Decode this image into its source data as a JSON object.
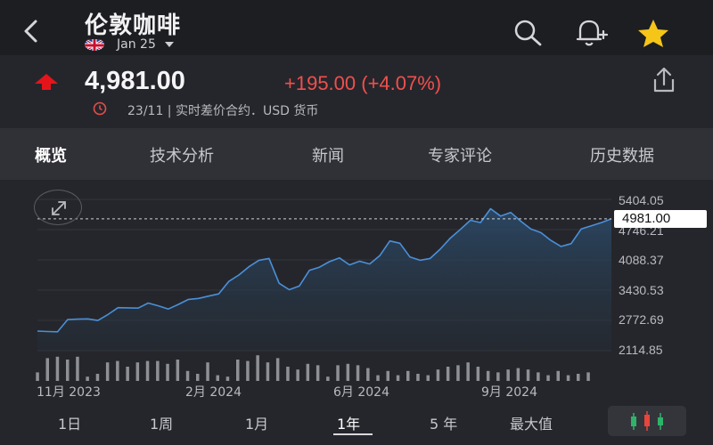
{
  "header": {
    "title": "伦敦咖啡",
    "contract": "Jan 25",
    "flag_icon": "uk-flag-icon",
    "icons": [
      "back-icon",
      "search-icon",
      "alert-add-icon",
      "star-icon"
    ],
    "star_color": "#f5c518"
  },
  "quote": {
    "price": "4,981.00",
    "change": "+195.00 (+4.07%)",
    "direction_icon": "arrow-up-icon",
    "meta": "23/11 | 实时差价合约．USD 货币",
    "up_color": "#f0504d"
  },
  "tabs": [
    {
      "label": "概览",
      "active": true
    },
    {
      "label": "技术分析",
      "active": false
    },
    {
      "label": "新闻",
      "active": false
    },
    {
      "label": "专家评论",
      "active": false
    },
    {
      "label": "历史数据",
      "active": false
    }
  ],
  "chart_data": {
    "type": "area",
    "line_color": "#4a90d9",
    "y_ticks": [
      "5404.05",
      "4746.21",
      "4088.37",
      "3430.53",
      "2772.69",
      "2114.85"
    ],
    "ylim": [
      2114.85,
      5404.05
    ],
    "x_ticks": [
      "11月 2023",
      "2月 2024",
      "6月 2024",
      "9月 2024"
    ],
    "last_price_label": "4981.00",
    "last_price": 4981.0,
    "values": [
      2540,
      2530,
      2525,
      2790,
      2800,
      2805,
      2770,
      2900,
      3050,
      3045,
      3040,
      3150,
      3090,
      3020,
      3120,
      3230,
      3250,
      3300,
      3350,
      3620,
      3760,
      3940,
      4080,
      4120,
      3580,
      3440,
      3520,
      3860,
      3930,
      4050,
      4130,
      3980,
      4060,
      4000,
      4180,
      4500,
      4450,
      4150,
      4080,
      4120,
      4320,
      4560,
      4750,
      4950,
      4900,
      5200,
      5040,
      5120,
      4930,
      4760,
      4680,
      4510,
      4380,
      4440,
      4760,
      4830,
      4900,
      4981
    ],
    "volume": [
      0.3,
      0.8,
      0.85,
      0.75,
      0.85,
      0.15,
      0.25,
      0.65,
      0.7,
      0.5,
      0.65,
      0.7,
      0.7,
      0.6,
      0.75,
      0.35,
      0.25,
      0.65,
      0.2,
      0.15,
      0.75,
      0.7,
      0.9,
      0.65,
      0.8,
      0.5,
      0.4,
      0.6,
      0.55,
      0.15,
      0.55,
      0.6,
      0.55,
      0.45,
      0.2,
      0.35,
      0.2,
      0.35,
      0.25,
      0.2,
      0.4,
      0.5,
      0.55,
      0.65,
      0.5,
      0.35,
      0.3,
      0.4,
      0.45,
      0.4,
      0.3,
      0.2,
      0.35,
      0.2,
      0.25,
      0.3
    ]
  },
  "ranges": [
    {
      "label": "1日",
      "active": false
    },
    {
      "label": "1周",
      "active": false
    },
    {
      "label": "1月",
      "active": false
    },
    {
      "label": "1年",
      "active": true
    },
    {
      "label": "5 年",
      "active": false
    },
    {
      "label": "最大值",
      "active": false
    }
  ],
  "chart_type_icon": "candlestick-icon"
}
